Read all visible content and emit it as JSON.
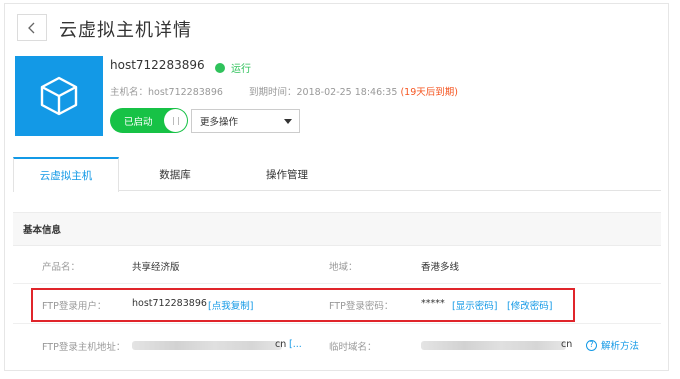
{
  "header": {
    "back_icon": "chevron-left-icon",
    "title": "云虚拟主机详情"
  },
  "product": {
    "icon": "cube-icon",
    "icon_color": "#1399e6",
    "host_name": "host712283896",
    "status": "运行",
    "status_color": "#2fc25b",
    "hostname_label": "主机名：",
    "hostname_value": "host712283896",
    "expire_label": "到期时间：",
    "expire_value": "2018-02-25 18:46:35",
    "expire_warning": "(19天后到期)",
    "warning_color": "#f5541f"
  },
  "controls": {
    "toggle_label": "已启动",
    "toggle_on": true,
    "toggle_color": "#17c246",
    "more_ops_label": "更多操作"
  },
  "tabs": [
    {
      "label": "云虚拟主机",
      "active": true
    },
    {
      "label": "数据库",
      "active": false
    },
    {
      "label": "操作管理",
      "active": false
    }
  ],
  "section_title": "基本信息",
  "rows": {
    "product_label": "产品名：",
    "product_value": "共享经济版",
    "region_label": "地域：",
    "region_value": "香港多线",
    "ftp_user_label": "FTP登录用户：",
    "ftp_user_value": "host712283896",
    "ftp_user_copy": "[点我复制]",
    "ftp_pwd_label": "FTP登录密码：",
    "ftp_pwd_value": "*****",
    "ftp_pwd_show": "[显示密码]",
    "ftp_pwd_modify": "[修改密码]",
    "ftp_addr_label": "FTP登录主机地址：",
    "ftp_addr_suffix": "cn",
    "ftp_addr_link": "[...",
    "temp_domain_label": "临时域名：",
    "temp_domain_suffix": "cn",
    "resolve_help": "解析方法",
    "help_icon": "question-circle-icon"
  },
  "accent_color": "#1399e6",
  "highlight_color": "#e0252b"
}
